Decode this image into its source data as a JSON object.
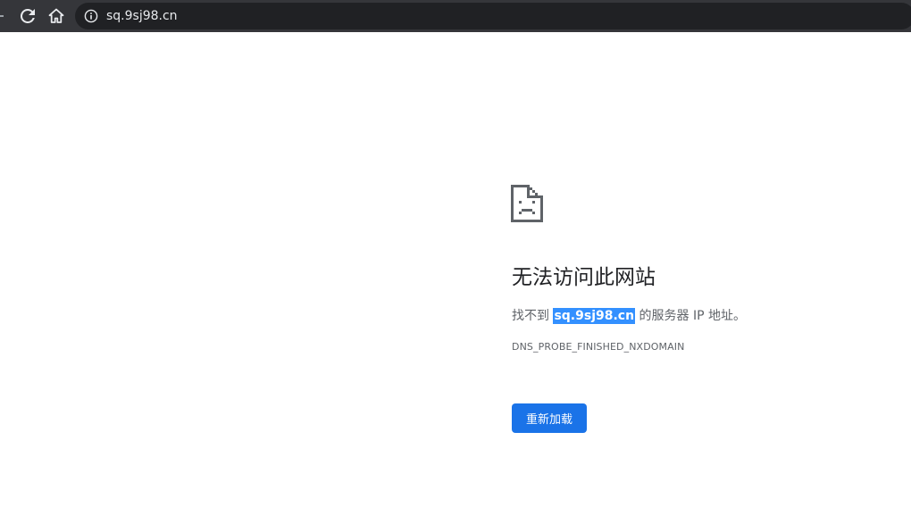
{
  "browser": {
    "url": "sq.9sj98.cn",
    "toolbar_background": "#35363a",
    "omnibox_background": "#202124"
  },
  "error_page": {
    "icon": "sad-page-icon",
    "title": "无法访问此网站",
    "detail_prefix": "找不到 ",
    "detail_host": "sq.9sj98.cn",
    "detail_suffix": " 的服务器 IP 地址。",
    "error_code": "DNS_PROBE_FINISHED_NXDOMAIN",
    "reload_label": "重新加载",
    "button_color": "#1a73e8",
    "highlight_color": "#3390ff"
  }
}
